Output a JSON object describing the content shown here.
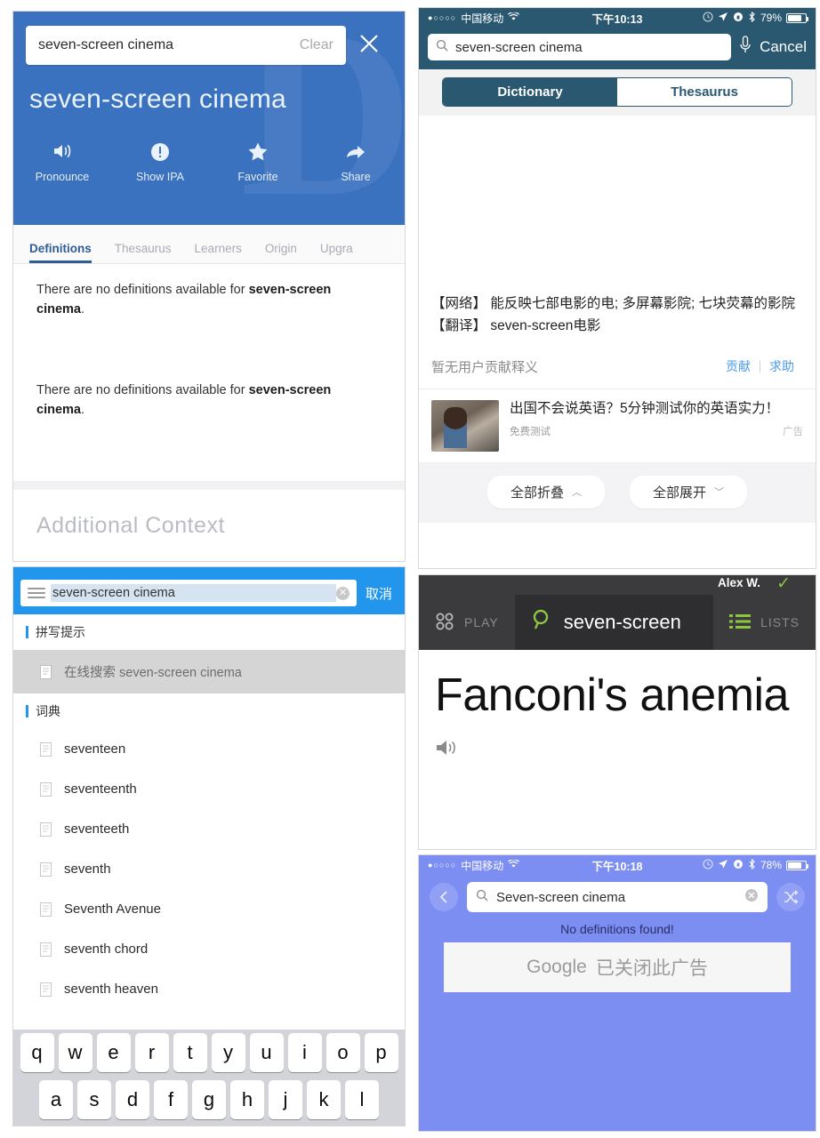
{
  "panel_dictionary_com": {
    "search_value": "seven-screen cinema",
    "clear_label": "Clear",
    "close_icon": "close-icon",
    "headword": "seven-screen cinema",
    "actions": [
      {
        "icon": "speaker-icon",
        "label": "Pronounce"
      },
      {
        "icon": "exclamation-circle-icon",
        "label": "Show IPA"
      },
      {
        "icon": "star-icon",
        "label": "Favorite"
      },
      {
        "icon": "share-arrow-icon",
        "label": "Share"
      }
    ],
    "tabs": [
      {
        "label": "Definitions",
        "active": true
      },
      {
        "label": "Thesaurus",
        "active": false
      },
      {
        "label": "Learners",
        "active": false
      },
      {
        "label": "Origin",
        "active": false
      },
      {
        "label": "Upgra",
        "active": false
      }
    ],
    "no_definition_1_prefix": "There are no definitions available for ",
    "no_definition_1_bold": "seven-screen cinema",
    "no_definition_1_suffix": ".",
    "no_definition_2_prefix": "There are no definitions available for ",
    "no_definition_2_bold": "seven-screen cinema",
    "no_definition_2_suffix": ".",
    "additional_context": "Additional Context",
    "watermark": "D"
  },
  "panel_suggestions": {
    "menu_icon": "hamburger-icon",
    "input_value": "seven-screen cinema",
    "clear_icon": "clear-circle-icon",
    "cancel_label": "取消",
    "section_spelling": "拼写提示",
    "online_search_label": "在线搜索 seven-screen cinema",
    "section_dictionary": "词典",
    "items": [
      "seventeen",
      "seventeenth",
      "seventeeth",
      "seventh",
      "Seventh Avenue",
      "seventh chord",
      "seventh heaven"
    ],
    "keyboard_row1": [
      "q",
      "w",
      "e",
      "r",
      "t",
      "y",
      "u",
      "i",
      "o",
      "p"
    ],
    "keyboard_row2": [
      "a",
      "s",
      "d",
      "f",
      "g",
      "h",
      "j",
      "k",
      "l"
    ]
  },
  "panel_youdao": {
    "status": {
      "dots": "●○○○○",
      "carrier": "中国移动",
      "wifi_icon": "wifi-icon",
      "time": "下午10:13",
      "alarm_icon": "alarm-icon",
      "location_icon": "location-arrow-icon",
      "rotation_icon": "rotation-lock-icon",
      "bluetooth_icon": "bluetooth-icon",
      "battery_pct": "79%"
    },
    "search_icon": "search-icon",
    "search_value": "seven-screen cinema",
    "mic_icon": "microphone-icon",
    "cancel_label": "Cancel",
    "segments": [
      {
        "label": "Dictionary",
        "active": true
      },
      {
        "label": "Thesaurus",
        "active": false
      }
    ],
    "def_network_tag": "【网络】",
    "def_network_text": "能反映七部电影的电; 多屏幕影院; 七块荧幕的影院",
    "def_translate_tag": "【翻译】",
    "def_translate_text": "seven-screen电影",
    "contribution_empty": "暂无用户贡献释义",
    "contribute_link": "贡献",
    "help_link": "求助",
    "ad_title": "出国不会说英语？5分钟测试你的英语实力！",
    "ad_sub": "免费测试",
    "ad_flag": "广告",
    "collapse_all": "全部折叠",
    "collapse_icon": "chevron-up-icon",
    "expand_all": "全部展开",
    "expand_icon": "chevron-down-icon"
  },
  "panel_merriam": {
    "user_name": "Alex W.",
    "check_icon": "check-icon",
    "nav": [
      {
        "icon": "grid-icon",
        "label": "PLAY"
      },
      {
        "icon": "search-icon",
        "label": "seven-screen"
      },
      {
        "icon": "list-icon",
        "label": "LISTS"
      }
    ],
    "headword": "Fanconi's anemia",
    "speaker_icon": "speaker-icon"
  },
  "panel_purple": {
    "status": {
      "dots": "●○○○○",
      "carrier": "中国移动",
      "wifi_icon": "wifi-icon",
      "time": "下午10:18",
      "alarm_icon": "alarm-icon",
      "location_icon": "location-arrow-icon",
      "rotation_icon": "rotation-lock-icon",
      "bluetooth_icon": "bluetooth-icon",
      "battery_pct": "78%"
    },
    "back_icon": "chevron-left-icon",
    "search_icon": "search-icon",
    "search_value": "Seven-screen cinema",
    "clear_icon": "clear-circle-icon",
    "shuffle_icon": "shuffle-icon",
    "no_definitions": "No definitions found!",
    "ad_brand": "Google",
    "ad_text": "已关闭此广告"
  },
  "colors": {
    "dictionary_blue": "#3b72bf",
    "youdao_navy": "#2b5871",
    "suggest_blue": "#2196ec",
    "merriam_dark": "#3b3b3e",
    "merriam_green": "#8cc63e",
    "purple": "#7c8ef2",
    "link_blue": "#4a9be8"
  }
}
